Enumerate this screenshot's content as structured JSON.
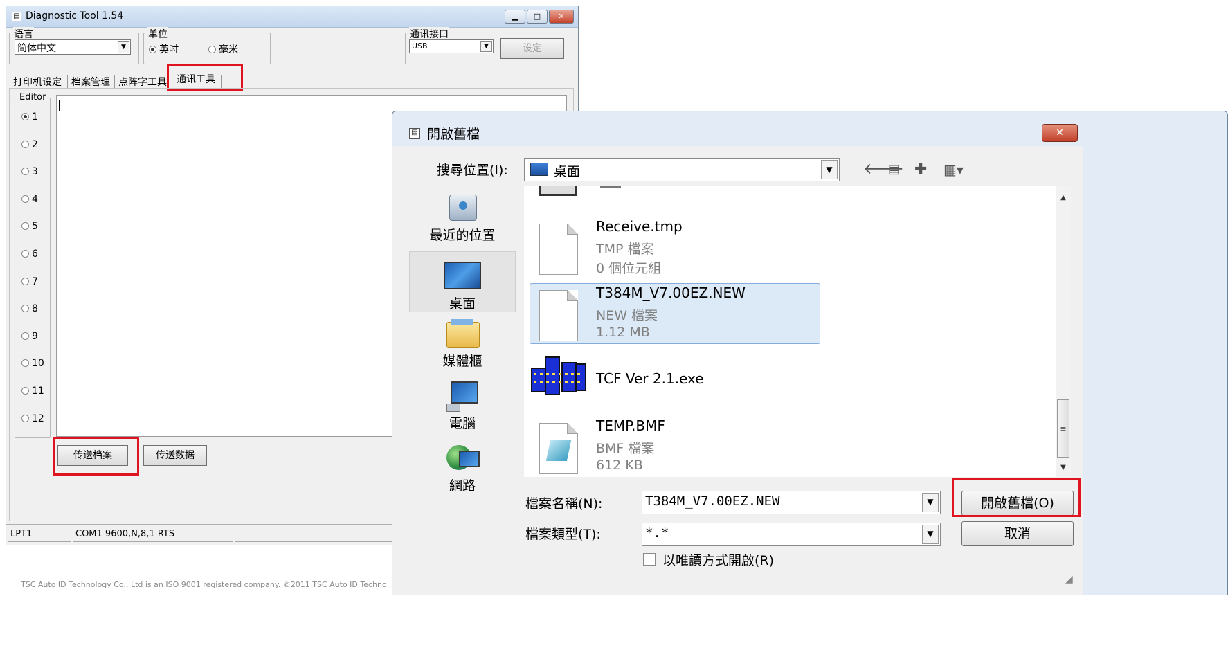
{
  "main_window": {
    "title": "Diagnostic Tool 1.54",
    "language_label": "语言",
    "language_value": "简体中文",
    "unit_label": "单位",
    "unit_options": [
      "英吋",
      "毫米"
    ],
    "comm_label": "通讯接口",
    "comm_value": "USB",
    "set_button": "设定",
    "tabs": [
      "打印机设定",
      "档案管理",
      "点阵字工具",
      "通讯工具"
    ],
    "active_tab": "通讯工具",
    "editor_label": "Editor",
    "editor_options": [
      "1",
      "2",
      "3",
      "4",
      "5",
      "6",
      "7",
      "8",
      "9",
      "10",
      "11",
      "12"
    ],
    "send_file_button": "传送档案",
    "send_data_button": "传送数据",
    "status_lpt": "LPT1",
    "status_com": "COM1 9600,N,8,1 RTS"
  },
  "footer_text": "TSC Auto ID Technology Co., Ltd is an ISO 9001 registered company. ©2011 TSC Auto ID Techno",
  "dialog": {
    "title": "開啟舊檔",
    "look_in_label": "搜尋位置(I):",
    "look_in_value": "桌面",
    "places": [
      "最近的位置",
      "桌面",
      "媒體櫃",
      "電腦",
      "網路"
    ],
    "selected_place": "桌面",
    "files": [
      {
        "name": "Receive.tmp",
        "type": "TMP 檔案",
        "size": "0 個位元組",
        "icon": "blank-document-icon"
      },
      {
        "name": "T384M_V7.00EZ.NEW",
        "type": "NEW 檔案",
        "size": "1.12 MB",
        "icon": "blank-document-icon"
      },
      {
        "name": "TCF Ver 2.1.exe",
        "type": "",
        "size": "",
        "icon": "application-icon"
      },
      {
        "name": "TEMP.BMF",
        "type": "BMF 檔案",
        "size": "612 KB",
        "icon": "bmf-document-icon"
      }
    ],
    "selected_file": "T384M_V7.00EZ.NEW",
    "filename_label": "檔案名稱(N):",
    "filename_value": "T384M_V7.00EZ.NEW",
    "filetype_label": "檔案類型(T):",
    "filetype_value": "*.*",
    "readonly_label": "以唯讀方式開啟(R)",
    "open_button": "開啟舊檔(O)",
    "cancel_button": "取消",
    "highlight_color": "#e0141e"
  }
}
